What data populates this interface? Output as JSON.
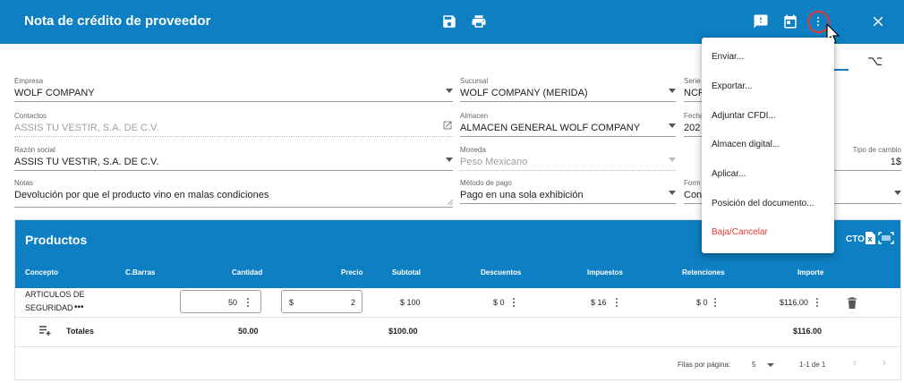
{
  "header": {
    "title": "Nota de crédito de proveedor",
    "icons": [
      "save-icon",
      "print-icon",
      "feedback-icon",
      "calendar-icon",
      "more-vert-icon",
      "close-icon"
    ]
  },
  "form": {
    "empresa": {
      "label": "Empresa",
      "value": "WOLF COMPANY"
    },
    "sucursal": {
      "label": "Sucursal",
      "value": "WOLF COMPANY (MERIDA)"
    },
    "serie": {
      "label": "Serie",
      "value": "NCF"
    },
    "contactos": {
      "label": "Contactos",
      "value": "ASSIS TU VESTIR, S.A. DE C.V."
    },
    "almacen": {
      "label": "Almacen",
      "value": "ALMACEN GENERAL WOLF COMPANY"
    },
    "fecha": {
      "label": "Fecha",
      "value": "202"
    },
    "razon": {
      "label": "Razón social",
      "value": "ASSIS TU VESTIR, S.A. DE C.V."
    },
    "moneda": {
      "label": "Moneda",
      "value": "Peso Mexicano"
    },
    "tipo_cambio": {
      "label": "Tipo de cambio",
      "value": "1$"
    },
    "notas": {
      "label": "Notas",
      "value": "Devolución por que el producto vino en malas condiciones"
    },
    "metodo": {
      "label": "Método de pago",
      "value": "Pago en una sola exhibición"
    },
    "forma": {
      "label": "Form",
      "value": "Con"
    }
  },
  "products": {
    "title": "Productos",
    "action_fragment": "CTO",
    "columns": [
      "Concepto",
      "C.Barras",
      "Cantidad",
      "Precio",
      "Subtotal",
      "Descuentos",
      "Impuestos",
      "Retenciones",
      "Importe"
    ],
    "row": {
      "concepto_line1": "ARTICULOS DE",
      "concepto_line2": "SEGURIDAD",
      "concepto_more": "•••",
      "cantidad": "50",
      "precio_symbol": "$",
      "precio": "2",
      "subtotal": "$ 100",
      "descuentos": "$ 0",
      "impuestos": "$ 16",
      "retenciones": "$ 0",
      "importe": "$116.00"
    },
    "totals": {
      "label": "Totales",
      "cantidad": "50.00",
      "subtotal": "$100.00",
      "importe": "$116.00"
    },
    "pager": {
      "rows_label": "Filas por página:",
      "rows_value": "5",
      "range": "1-1 de 1"
    }
  },
  "menu": {
    "items": [
      "Enviar...",
      "Exportar...",
      "Adjuntar CFDI...",
      "Almacen digital...",
      "Aplicar...",
      "Posición del documento...",
      "Baja/Cancelar"
    ],
    "danger_color": "#e53935"
  },
  "colors": {
    "primary": "#0d7fc2"
  }
}
